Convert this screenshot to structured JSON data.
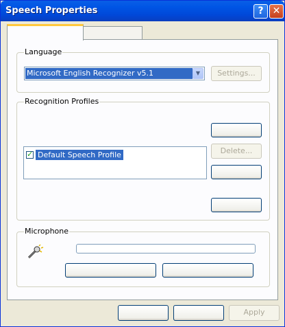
{
  "window": {
    "title": "Speech Properties"
  },
  "titlebar": {
    "help_glyph": "?",
    "close_glyph": "✕"
  },
  "tabs": [
    {
      "label": ""
    },
    {
      "label": ""
    }
  ],
  "language": {
    "legend": "Language",
    "selected_engine": "Microsoft English Recognizer v5.1",
    "settings_label": "Settings..."
  },
  "profiles": {
    "legend": "Recognition Profiles",
    "items": [
      {
        "label": "Default Speech Profile",
        "checked": true
      }
    ],
    "delete_label": "Delete...",
    "new_label": "",
    "settings_label": "",
    "train_label": ""
  },
  "microphone": {
    "legend": "Microphone",
    "level": 0,
    "audio_input_label": "",
    "configure_label": ""
  },
  "footer": {
    "ok_label": "",
    "cancel_label": "",
    "apply_label": "Apply"
  }
}
